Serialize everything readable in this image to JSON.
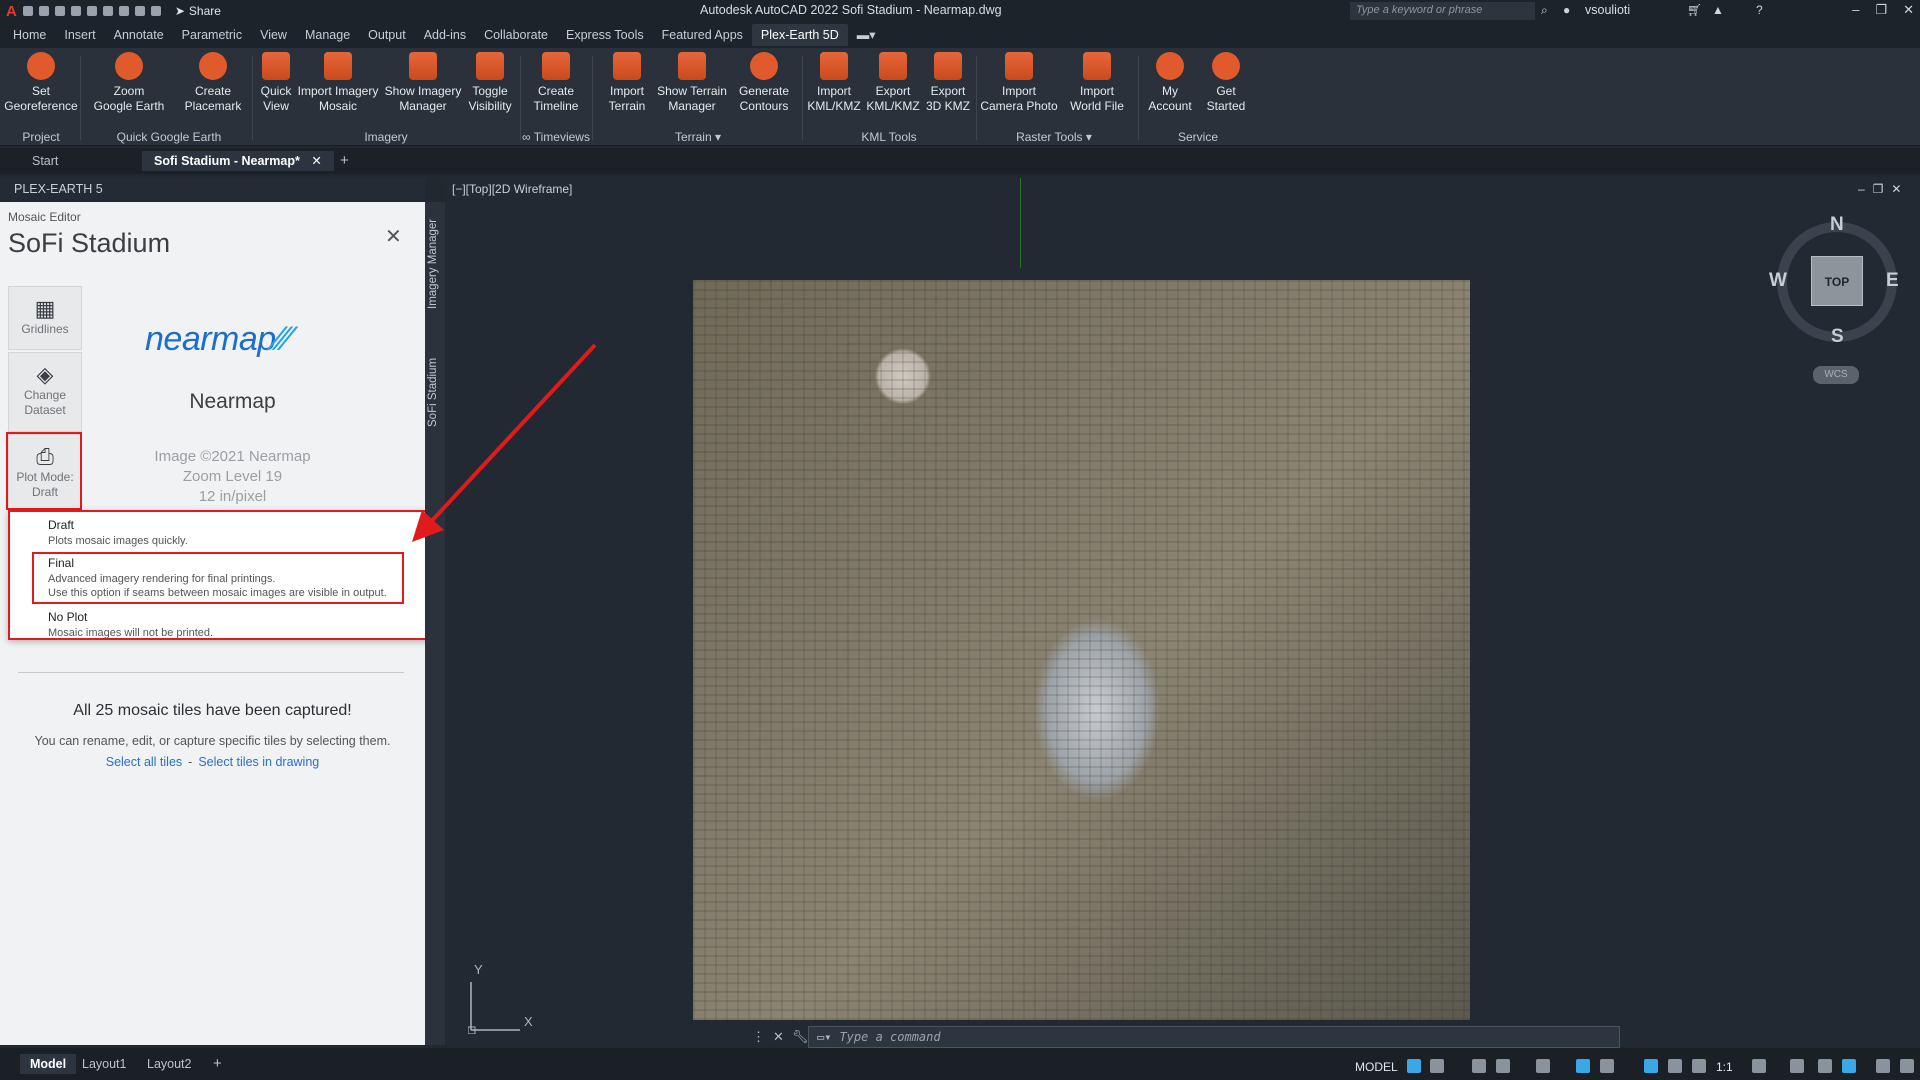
{
  "titlebar": {
    "app_letter": "A",
    "share_label": "Share",
    "title": "Autodesk AutoCAD 2022   Sofi Stadium - Nearmap.dwg",
    "search_placeholder": "Type a keyword or phrase",
    "user": "vsoulioti"
  },
  "menu_tabs": [
    "Home",
    "Insert",
    "Annotate",
    "Parametric",
    "View",
    "Manage",
    "Output",
    "Add-ins",
    "Collaborate",
    "Express Tools",
    "Featured Apps",
    "Plex-Earth 5D"
  ],
  "ribbon": {
    "buttons": [
      {
        "l1": "Set",
        "l2": "Georeference"
      },
      {
        "l1": "Zoom",
        "l2": "Google Earth"
      },
      {
        "l1": "Create",
        "l2": "Placemark"
      },
      {
        "l1": "Quick",
        "l2": "View"
      },
      {
        "l1": "Import Imagery",
        "l2": "Mosaic"
      },
      {
        "l1": "Show Imagery",
        "l2": "Manager"
      },
      {
        "l1": "Toggle",
        "l2": "Visibility"
      },
      {
        "l1": "Create",
        "l2": "Timeline"
      },
      {
        "l1": "Import",
        "l2": "Terrain"
      },
      {
        "l1": "Show Terrain",
        "l2": "Manager"
      },
      {
        "l1": "Generate",
        "l2": "Contours"
      },
      {
        "l1": "Import",
        "l2": "KML/KMZ"
      },
      {
        "l1": "Export",
        "l2": "KML/KMZ"
      },
      {
        "l1": "Export",
        "l2": "3D KMZ"
      },
      {
        "l1": "Import",
        "l2": "Camera Photo"
      },
      {
        "l1": "Import",
        "l2": "World File"
      },
      {
        "l1": "My",
        "l2": "Account"
      },
      {
        "l1": "Get",
        "l2": "Started"
      }
    ],
    "groups": [
      "Project",
      "Quick Google Earth",
      "Imagery",
      "∞ Timeviews",
      "Terrain ▾",
      "KML Tools",
      "Raster Tools ▾",
      "Service"
    ]
  },
  "doc_tabs": {
    "start": "Start",
    "active": "Sofi Stadium - Nearmap*"
  },
  "panel": {
    "header": "PLEX-EARTH 5",
    "crumb": "Mosaic Editor",
    "title": "SoFi Stadium",
    "gridlines": "Gridlines",
    "change_l1": "Change",
    "change_l2": "Dataset",
    "plot_l1": "Plot Mode:",
    "plot_l2": "Draft",
    "logo": "nearmap",
    "provider": "Nearmap",
    "copyright": "Image ©2021 Nearmap",
    "zoom": "Zoom Level 19",
    "resolution": "12 in/pixel",
    "options": [
      {
        "name": "Draft",
        "desc": "Plots mosaic images quickly."
      },
      {
        "name": "Final",
        "desc": "Advanced imagery rendering for final printings.",
        "desc2": "Use this option if seams between mosaic images are visible in output."
      },
      {
        "name": "No Plot",
        "desc": "Mosaic images will not be printed."
      }
    ],
    "captured": "All 25 mosaic tiles have been captured!",
    "captured_sub": "You can rename, edit, or capture specific tiles by selecting them.",
    "select_all": "Select all tiles",
    "select_drawing": "Select tiles in drawing"
  },
  "vtabs": [
    "Imagery Manager",
    "SoFi Stadium"
  ],
  "viewport_label": "[−][Top][2D Wireframe]",
  "viewcube": {
    "top": "TOP",
    "n": "N",
    "s": "S",
    "e": "E",
    "w": "W",
    "wcs": "WCS"
  },
  "ucs": {
    "x": "X",
    "y": "Y"
  },
  "command_placeholder": "Type a command",
  "layout_tabs": [
    "Model",
    "Layout1",
    "Layout2"
  ],
  "status": {
    "model": "MODEL",
    "scale": "1:1"
  },
  "colors": {
    "accent_red": "#e11b1b",
    "ribbon_orange": "#e05a2b",
    "nearmap_blue": "#1c6fc9",
    "link_blue": "#2a6fcf"
  }
}
